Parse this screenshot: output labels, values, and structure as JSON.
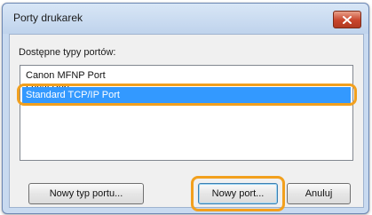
{
  "window": {
    "title": "Porty drukarek",
    "close_icon": "close-icon"
  },
  "ports": {
    "label": "Dostępne typy portów:",
    "items": [
      {
        "label": "Canon MFNP Port"
      },
      {
        "label": "Local Port"
      },
      {
        "label": "Standard TCP/IP Port",
        "selected": true
      }
    ]
  },
  "buttons": {
    "new_port_type": "Nowy typ portu...",
    "new_port": "Nowy port...",
    "cancel": "Anuluj"
  },
  "colors": {
    "selection": "#3399ff",
    "highlight_ring": "#f2a01e"
  }
}
